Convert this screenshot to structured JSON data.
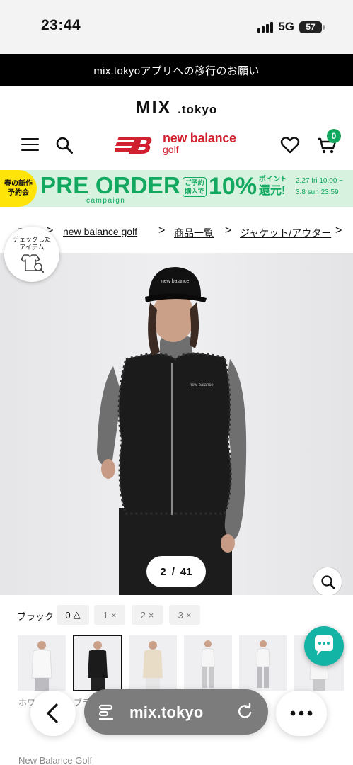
{
  "status_bar": {
    "time": "23:44",
    "network": "5G",
    "battery": "57"
  },
  "announcement": "mix.tokyoアプリへの移行のお願い",
  "header": {
    "site_logo": "MIX",
    "site_logo_sub": ".tokyo",
    "brand_logo": "new balance",
    "brand_logo_sub": "golf",
    "cart_count": "0"
  },
  "banner": {
    "tag_line1": "春の新作",
    "tag_line2": "予約会",
    "title": "PRE ORDER",
    "campaign": "campaign",
    "reserve_line1": "ご予約",
    "reserve_line2": "購入で",
    "percent": "10%",
    "point_label": "ポイント",
    "point_reward": "還元!",
    "date_start": "2.27 fri 10:00 ~",
    "date_end": "3.8 sun 23:59"
  },
  "breadcrumb": {
    "items": [
      "Top",
      "new balance golf",
      "商品一覧",
      "ジャケット/アウター"
    ],
    "separator": ">"
  },
  "checked_items": {
    "label_line1": "チェックした",
    "label_line2": "アイテム"
  },
  "gallery": {
    "current": "2",
    "separator": "/",
    "total": "41"
  },
  "variants": {
    "color_label": "ブラック",
    "sizes": [
      {
        "label": "0",
        "mark": "△",
        "available": true
      },
      {
        "label": "1",
        "mark": "×",
        "available": false
      },
      {
        "label": "2",
        "mark": "×",
        "available": false
      },
      {
        "label": "3",
        "mark": "×",
        "available": false
      }
    ]
  },
  "thumbnails": {
    "captions": [
      "ホワイト",
      "ブラック"
    ]
  },
  "browser": {
    "url": "mix.tokyo"
  },
  "footer": {
    "brand": "New Balance Golf"
  },
  "colors": {
    "accent_green": "#13a860",
    "brand_red": "#d1202f",
    "chat_teal": "#13b3a5",
    "banner_yellow": "#ffe40a"
  }
}
